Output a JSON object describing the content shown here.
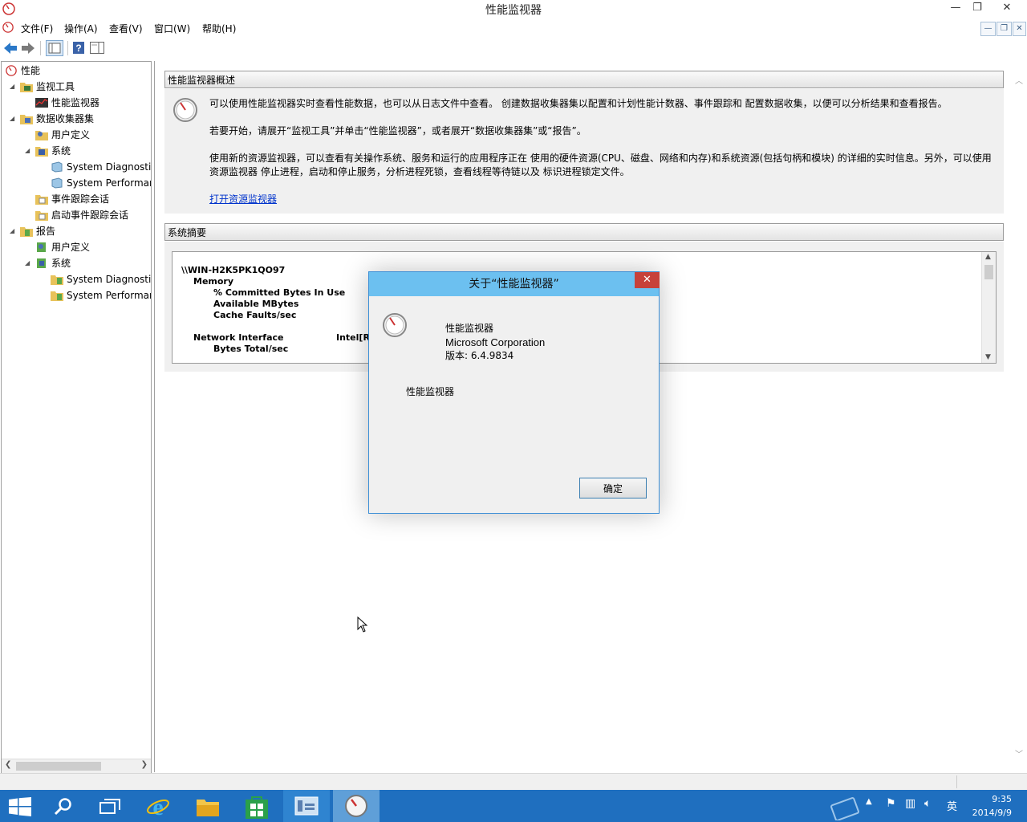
{
  "window": {
    "title": "性能监视器",
    "controls": {
      "minimize": "—",
      "restore": "❐",
      "close": "✕"
    }
  },
  "menubar": {
    "items": [
      "文件(F)",
      "操作(A)",
      "查看(V)",
      "窗口(W)",
      "帮助(H)"
    ]
  },
  "tree": {
    "root": "性能",
    "monitor_tools": "监视工具",
    "perf_monitor": "性能监视器",
    "data_collector_sets": "数据收集器集",
    "user_defined": "用户定义",
    "system": "系统",
    "sys_diag": "System Diagnostics",
    "sys_perf": "System Performance",
    "event_trace": "事件跟踪会话",
    "startup_event_trace": "启动事件跟踪会话",
    "reports": "报告",
    "rep_user_defined": "用户定义",
    "rep_system": "系统",
    "rep_sys_diag": "System Diagnostics",
    "rep_sys_perf": "System Performance"
  },
  "overview": {
    "header": "性能监视器概述",
    "p1": "可以使用性能监视器实时查看性能数据，也可以从日志文件中查看。 创建数据收集器集以配置和计划性能计数器、事件跟踪和 配置数据收集，以便可以分析结果和查看报告。",
    "p2": "若要开始，请展开“监视工具”并单击“性能监视器”，或者展开“数据收集器集”或“报告”。",
    "p3": "使用新的资源监视器，可以查看有关操作系统、服务和运行的应用程序正在 使用的硬件资源(CPU、磁盘、网络和内存)和系统资源(包括句柄和模块) 的详细的实时信息。另外，可以使用资源监视器 停止进程，启动和停止服务，分析进程死锁，查看线程等待链以及 标识进程锁定文件。",
    "link": "打开资源监视器"
  },
  "summary": {
    "header": "系统摘要",
    "machine": "\\\\WIN-H2K5PK1QO97",
    "memory": "Memory",
    "counter1": "% Committed Bytes In Use",
    "counter2": "Available MBytes",
    "counter3": "Cache Faults/sec",
    "network": "Network Interface",
    "network_instance": "Intel[R]",
    "counter4": "Bytes Total/sec"
  },
  "dialog": {
    "title": "关于“性能监视器”",
    "close": "✕",
    "product": "性能监视器",
    "company": "Microsoft Corporation",
    "version": "版本: 6.4.9834",
    "description": "性能监视器",
    "ok": "确定"
  },
  "taskbar": {
    "ime": "英",
    "time": "9:35",
    "date": "2014/9/9"
  },
  "colors": {
    "taskbar": "#1f6fbf",
    "dialog_title": "#6cc0f0",
    "dialog_close": "#c7413a",
    "link": "#0033cc"
  }
}
